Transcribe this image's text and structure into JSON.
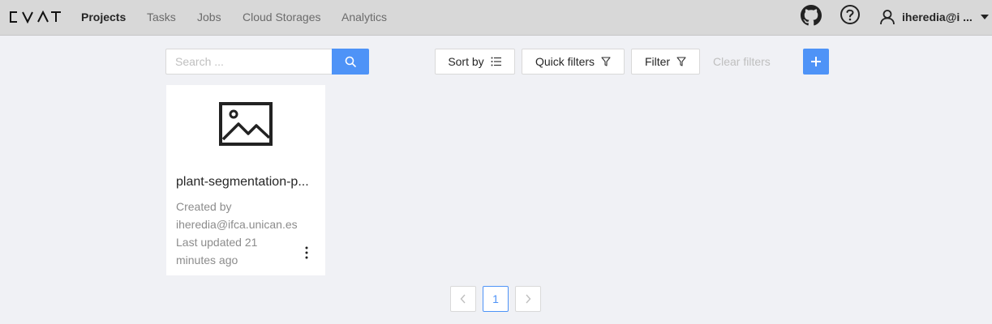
{
  "header": {
    "logo": "CVAT",
    "nav": [
      "Projects",
      "Tasks",
      "Jobs",
      "Cloud Storages",
      "Analytics"
    ],
    "active_nav": "Projects",
    "icons": [
      "github-icon",
      "help-icon",
      "user-icon"
    ],
    "user_name": "iheredia@i ..."
  },
  "toolbar": {
    "search_placeholder": "Search ...",
    "sort_by_label": "Sort by",
    "quick_filters_label": "Quick filters",
    "filter_label": "Filter",
    "clear_filters_label": "Clear filters",
    "add_label": "+"
  },
  "projects": [
    {
      "title": "plant-segmentation-p...",
      "created_by_label": "Created by",
      "owner": "iheredia@ifca.unican.es",
      "updated_line1": "Last updated 21",
      "updated_line2": "minutes ago"
    }
  ],
  "pagination": {
    "current_page": "1"
  },
  "colors": {
    "accent": "#4e93f7",
    "header_bg": "#d8d8d8",
    "page_bg": "#f0f1f5"
  }
}
